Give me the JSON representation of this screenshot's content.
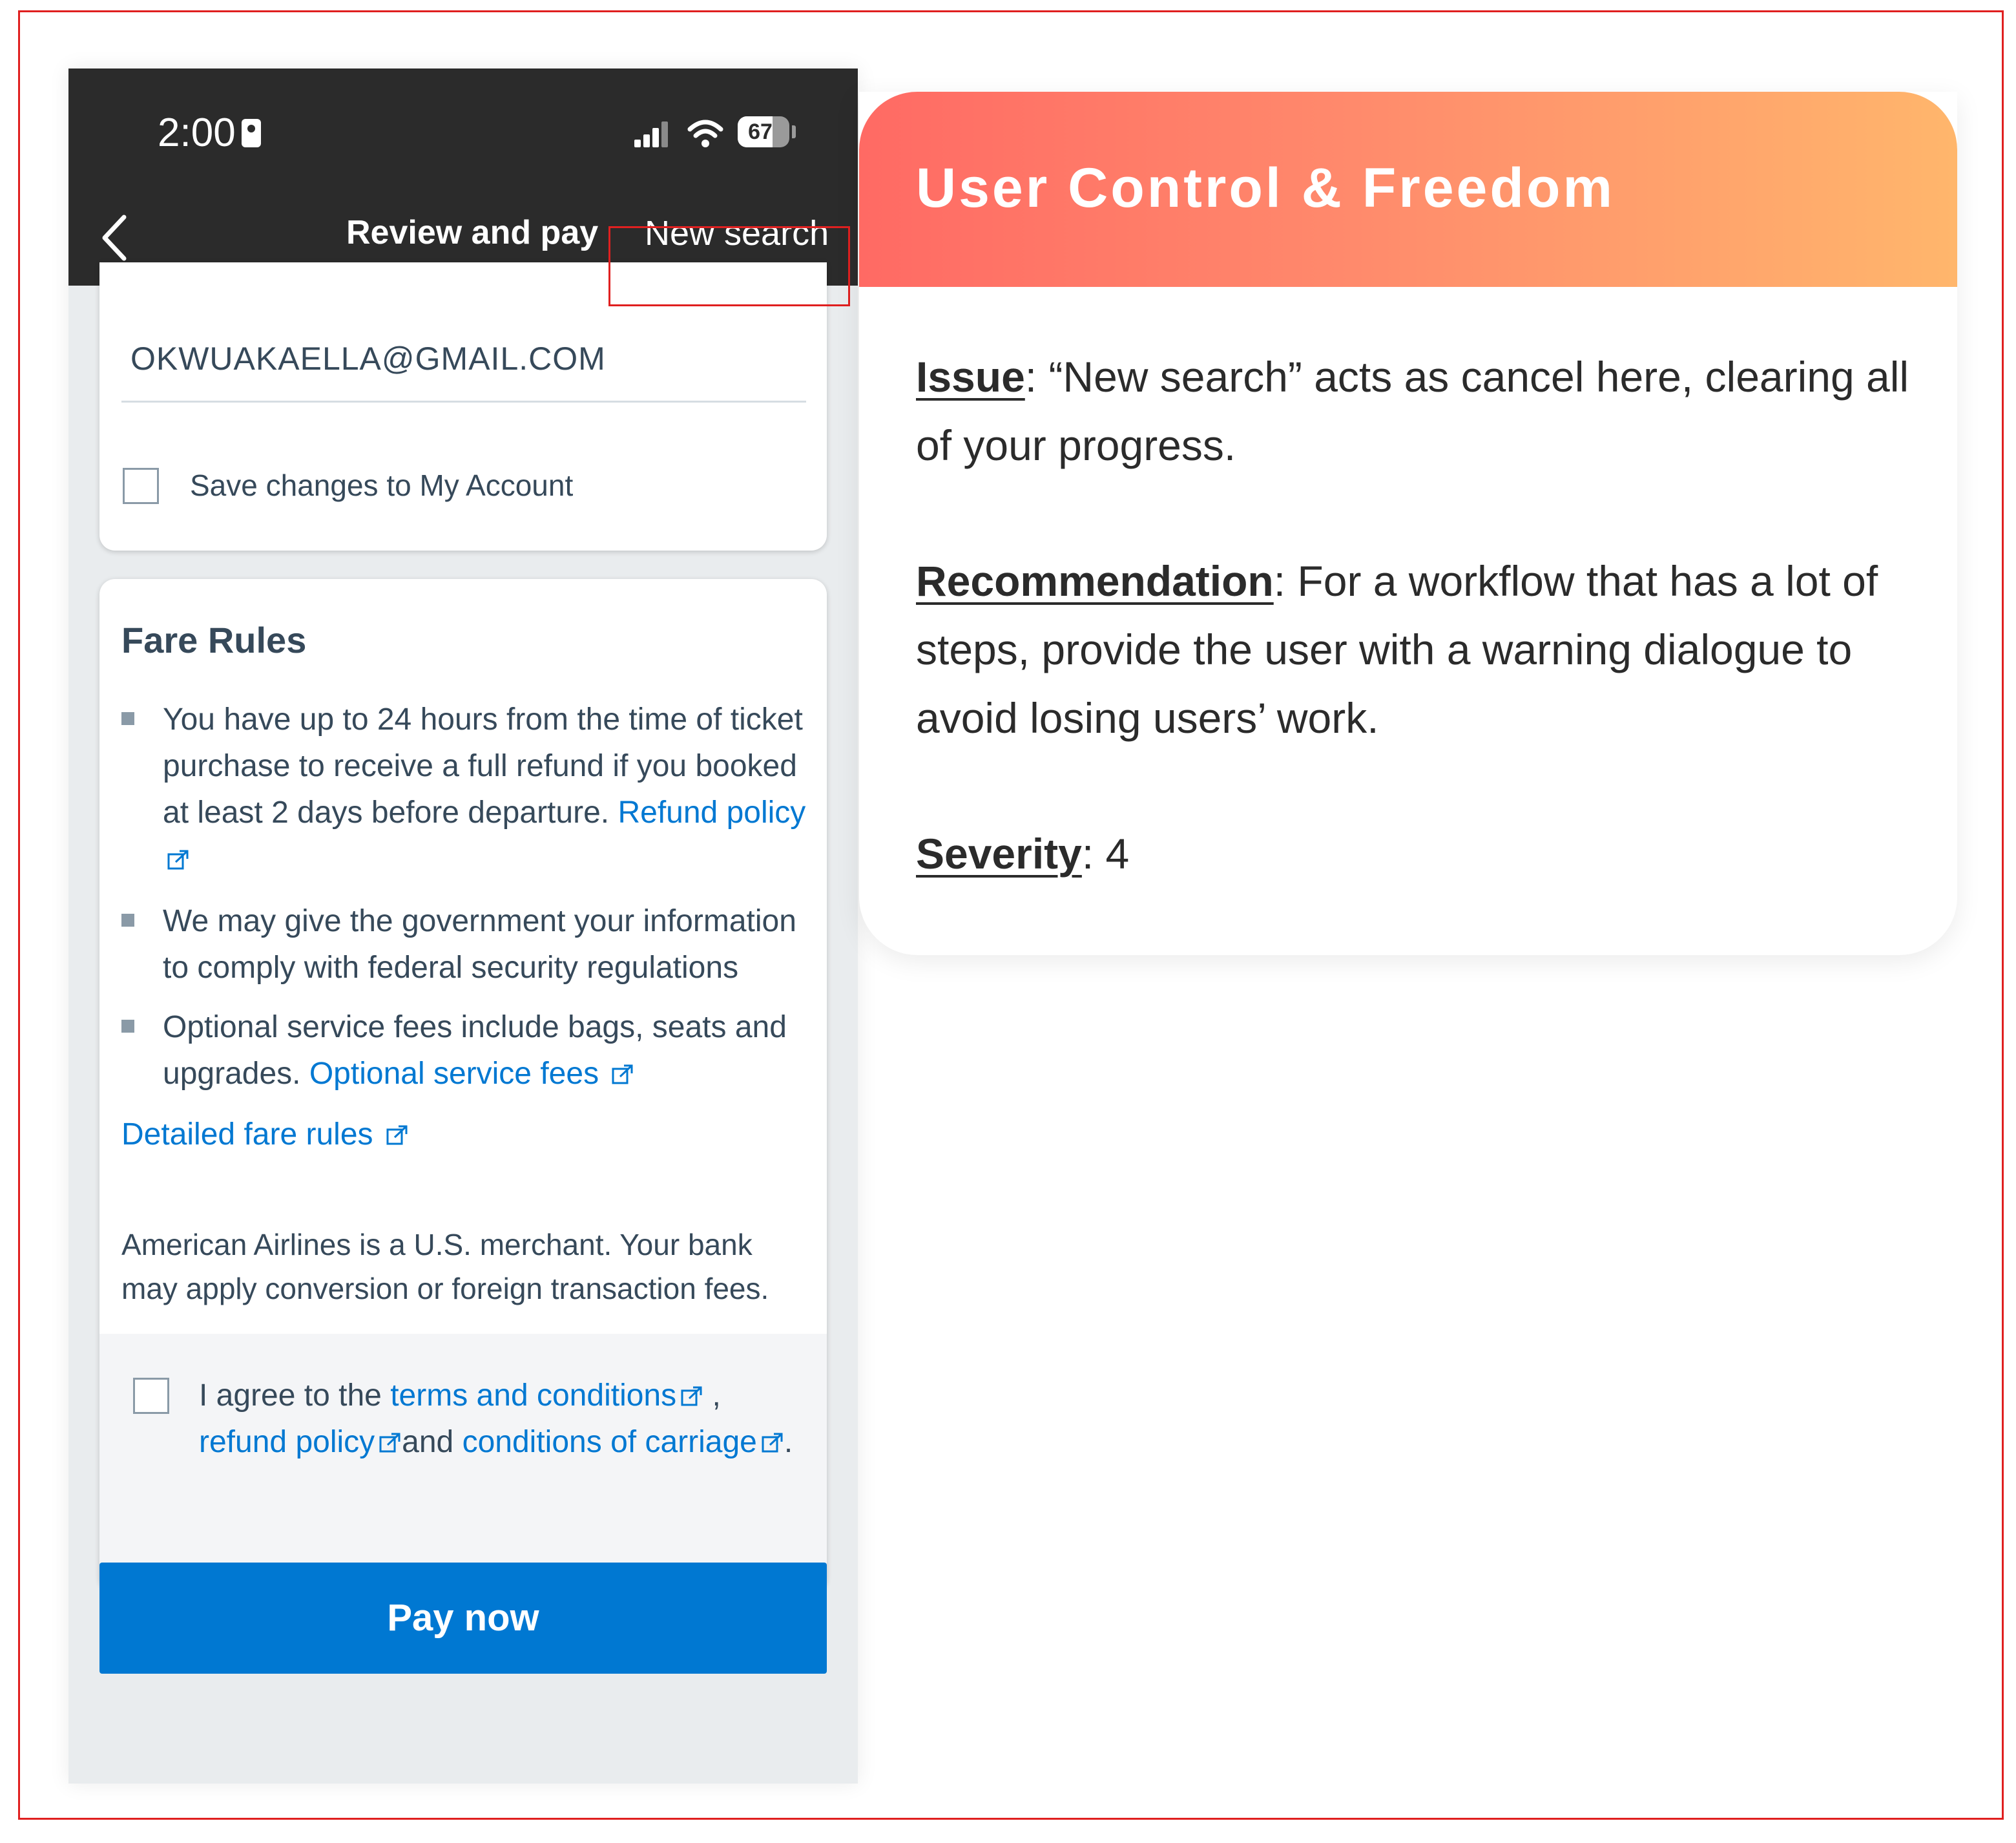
{
  "status_bar": {
    "time": "2:00",
    "battery": "67"
  },
  "nav": {
    "title": "Review and pay",
    "new_search_label": "New search"
  },
  "account": {
    "email": "OKWUAKAELLA@GMAIL.COM",
    "save_label": "Save changes to My Account"
  },
  "fare_rules": {
    "title": "Fare Rules",
    "rule1_text": "You have up to 24 hours from the time of ticket purchase to receive a full refund if you booked at least 2 days before departure.",
    "rule1_link": "Refund policy",
    "rule2_text": "We may give the government your information to comply with federal security regulations",
    "rule3_text": "Optional service fees include bags, seats and upgrades.",
    "rule3_link": "Optional service fees",
    "detailed_link": "Detailed fare rules",
    "merchant_note": "American Airlines is a U.S. merchant. Your bank may apply conversion or foreign transaction fees."
  },
  "agreement": {
    "prefix": "I agree to the",
    "terms_link": "terms and conditions",
    "comma": ",",
    "refund_link": "refund policy",
    "and_text": "and",
    "carriage_link": "conditions of carriage",
    "period": "."
  },
  "pay_button": "Pay now",
  "annotation": {
    "title": "User Control & Freedom",
    "issue_key": "Issue",
    "issue_text": ": “New search” acts as cancel here, clearing all of your progress.",
    "recommendation_key": "Recommendation",
    "recommendation_text": ": For a workflow that has a lot of steps, provide the user with a warning dialogue to avoid losing users’ work.",
    "severity_key": "Severity",
    "severity_text": ": 4"
  },
  "colors": {
    "link": "#0078d2",
    "highlight": "#e02020",
    "header_start": "#ff6a64",
    "header_end": "#ffb66c"
  }
}
